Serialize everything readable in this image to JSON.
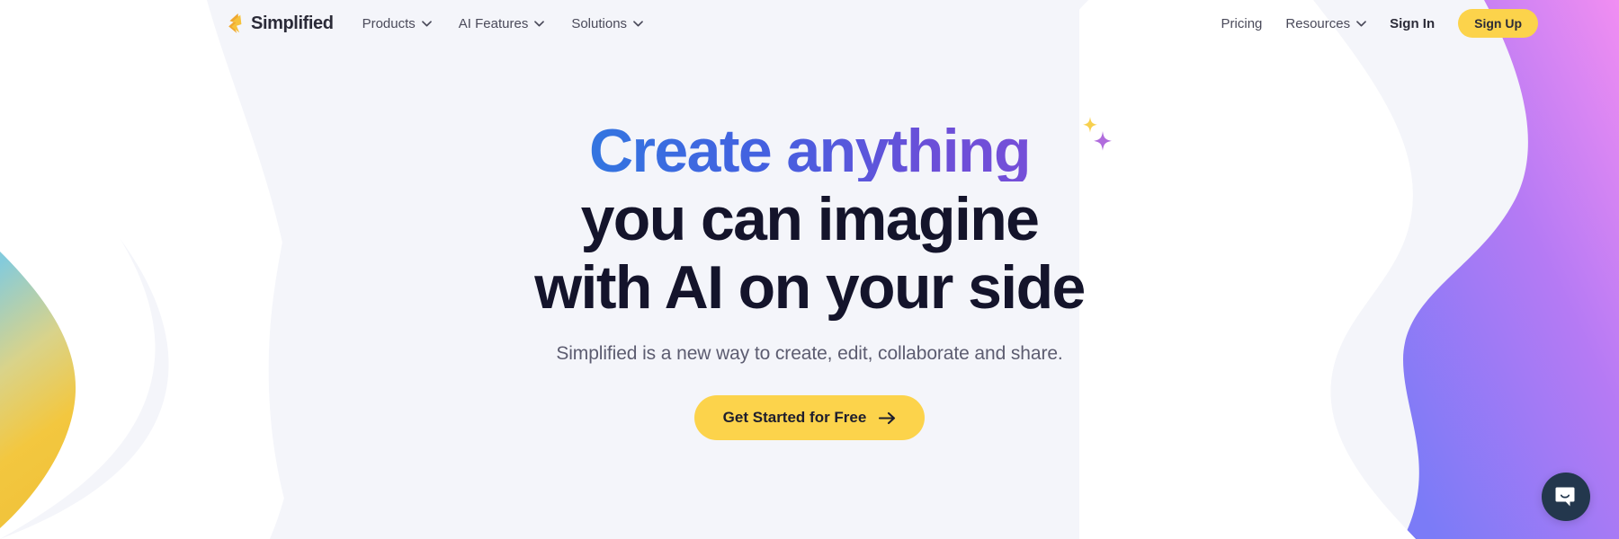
{
  "colors": {
    "page_bg": "#f4f5fa",
    "brand_yellow": "#fcd34b",
    "headline_dark": "#14142b",
    "gradient_start": "#2e7ce0",
    "gradient_end": "#7b4fd8",
    "chat_bubble_bg": "#23374d",
    "blob_right_start": "#ef8bf0",
    "blob_right_end": "#7b7bf5",
    "blob_left_start": "#7fc8d8",
    "blob_left_end": "#f2c53d"
  },
  "navbar": {
    "brand": {
      "name": "Simplified",
      "logo_icon": "simplified-bolt-logo"
    },
    "left_items": [
      {
        "label": "Products",
        "has_dropdown": true,
        "icon": "chevron-down-icon"
      },
      {
        "label": "AI Features",
        "has_dropdown": true,
        "icon": "chevron-down-icon"
      },
      {
        "label": "Solutions",
        "has_dropdown": true,
        "icon": "chevron-down-icon"
      }
    ],
    "right_items": [
      {
        "label": "Pricing",
        "has_dropdown": false
      },
      {
        "label": "Resources",
        "has_dropdown": true,
        "icon": "chevron-down-icon"
      }
    ],
    "sign_in_label": "Sign In",
    "sign_up_label": "Sign Up"
  },
  "hero": {
    "headline_line1": "Create anything",
    "headline_line2": "you can imagine",
    "headline_line3": "with AI on your side",
    "sparkle_icons": [
      "sparkle-yellow-icon",
      "sparkle-purple-icon"
    ],
    "subheadline": "Simplified is a new way to create, edit, collaborate and share.",
    "cta_label": "Get Started for Free",
    "cta_icon": "arrow-right-icon"
  },
  "chat_widget": {
    "icon": "chat-bubble-icon",
    "aria_label": "Open Intercom Messenger"
  }
}
